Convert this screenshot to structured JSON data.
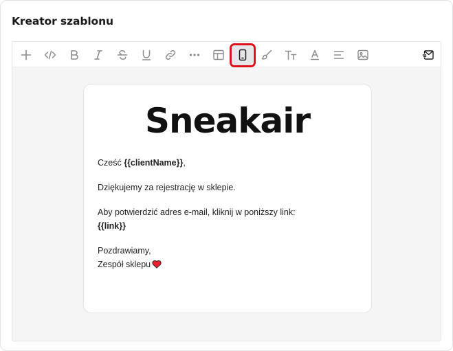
{
  "header": {
    "title": "Kreator szablonu"
  },
  "toolbar": {
    "buttons": [
      {
        "id": "add",
        "icon": "plus-icon"
      },
      {
        "id": "code",
        "icon": "code-icon"
      },
      {
        "id": "bold",
        "icon": "bold-icon"
      },
      {
        "id": "italic",
        "icon": "italic-icon"
      },
      {
        "id": "strike",
        "icon": "strikethrough-icon"
      },
      {
        "id": "underline",
        "icon": "underline-icon"
      },
      {
        "id": "link",
        "icon": "link-icon"
      },
      {
        "id": "more",
        "icon": "more-horizontal-icon"
      },
      {
        "id": "table",
        "icon": "table-icon"
      },
      {
        "id": "mobile",
        "icon": "mobile-preview-icon",
        "active": true
      },
      {
        "id": "brush",
        "icon": "brush-icon"
      },
      {
        "id": "font-size",
        "icon": "text-size-icon"
      },
      {
        "id": "font-color",
        "icon": "font-color-icon"
      },
      {
        "id": "align",
        "icon": "align-left-icon"
      },
      {
        "id": "image",
        "icon": "image-icon"
      },
      {
        "id": "preview-mail",
        "icon": "mail-preview-icon"
      }
    ],
    "highlight_color": "#e0101a"
  },
  "email": {
    "logo": "Sneakair",
    "greeting_prefix": "Cześć ",
    "greeting_var": "{{clientName}}",
    "greeting_suffix": ",",
    "thanks": "Dziękujemy za rejestrację w sklepie.",
    "confirm": "Aby potwierdzić adres e-mail, kliknij w poniższy link:",
    "link_var": "{{link}}",
    "regards": "Pozdrawiamy,",
    "signature": "Zespół sklepu",
    "signature_icon": "heart-icon"
  },
  "colors": {
    "toolbar_bg": "#ffffff",
    "canvas_bg": "#f5f5f6",
    "icon_color": "#8a8a90",
    "heart": "#e8202e"
  }
}
